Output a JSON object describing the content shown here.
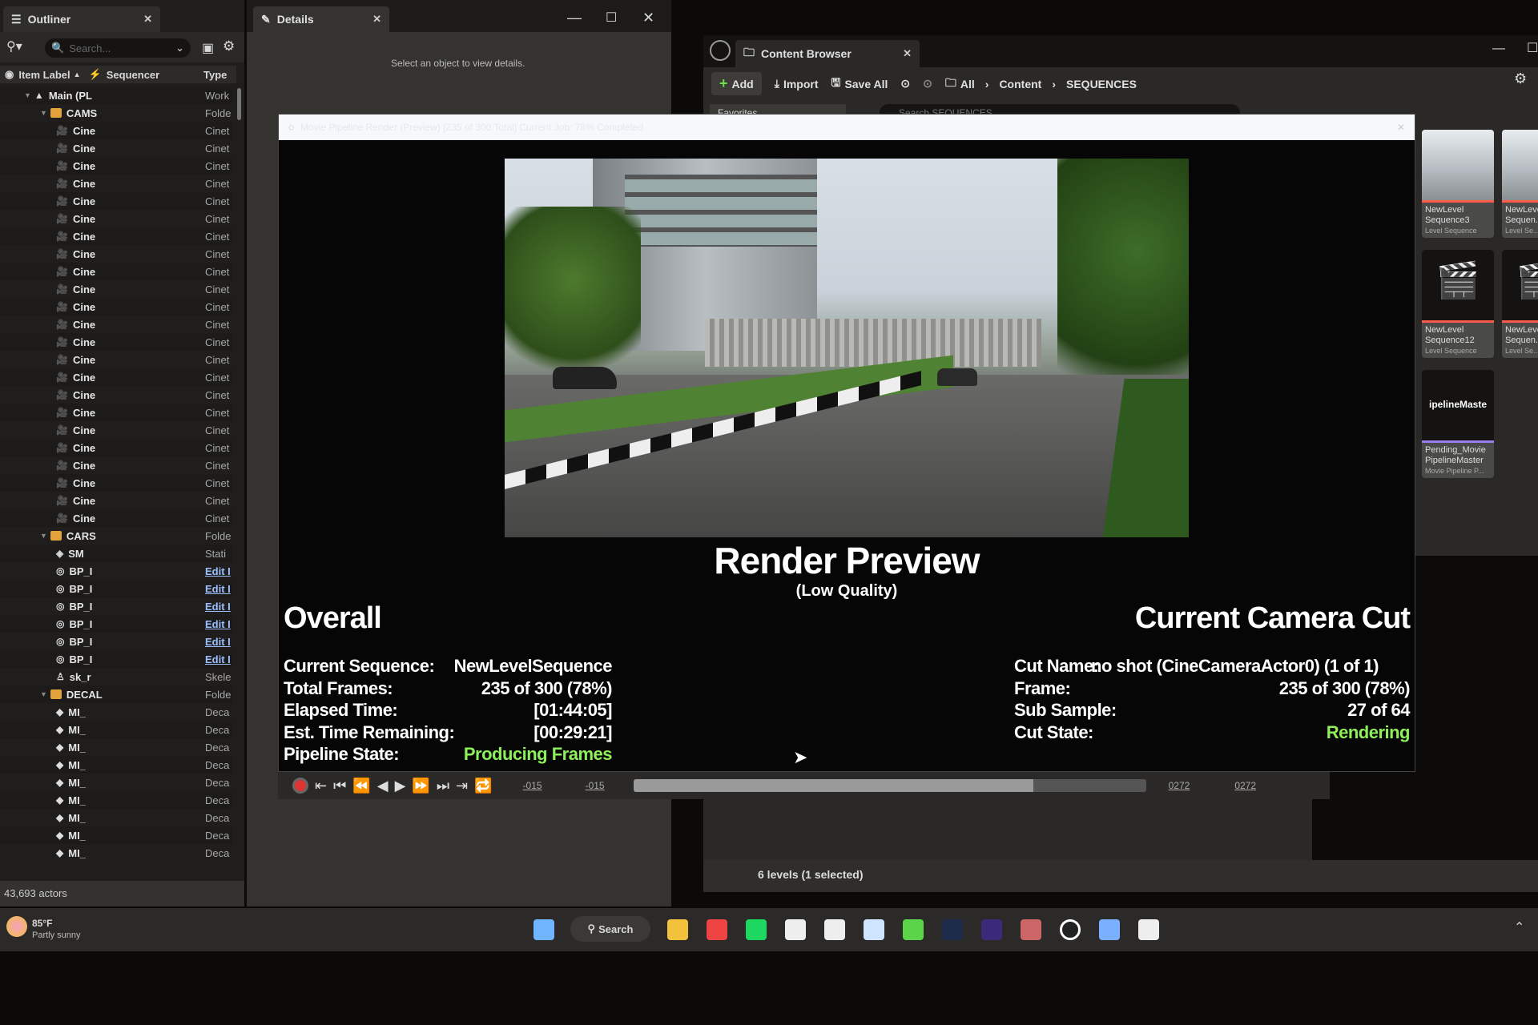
{
  "outliner": {
    "tab_label": "Outliner",
    "search_placeholder": "Search...",
    "columns": {
      "label": "Item Label",
      "sequencer": "Sequencer",
      "type": "Type"
    },
    "rows": [
      {
        "indent": 1,
        "kind": "world",
        "label": "Main (PL",
        "type": "Work"
      },
      {
        "indent": 2,
        "kind": "folder",
        "label": "CAMS",
        "type": "Folde"
      },
      {
        "indent": 3,
        "kind": "cam",
        "label": "Cine",
        "type": "Cinet"
      },
      {
        "indent": 3,
        "kind": "cam",
        "label": "Cine",
        "type": "Cinet"
      },
      {
        "indent": 3,
        "kind": "cam",
        "label": "Cine",
        "type": "Cinet"
      },
      {
        "indent": 3,
        "kind": "cam",
        "label": "Cine",
        "type": "Cinet"
      },
      {
        "indent": 3,
        "kind": "cam",
        "label": "Cine",
        "type": "Cinet"
      },
      {
        "indent": 3,
        "kind": "cam",
        "label": "Cine",
        "type": "Cinet"
      },
      {
        "indent": 3,
        "kind": "cam",
        "label": "Cine",
        "type": "Cinet"
      },
      {
        "indent": 3,
        "kind": "cam",
        "label": "Cine",
        "type": "Cinet"
      },
      {
        "indent": 3,
        "kind": "cam",
        "label": "Cine",
        "type": "Cinet"
      },
      {
        "indent": 3,
        "kind": "cam",
        "label": "Cine",
        "type": "Cinet"
      },
      {
        "indent": 3,
        "kind": "cam",
        "label": "Cine",
        "type": "Cinet"
      },
      {
        "indent": 3,
        "kind": "cam",
        "label": "Cine",
        "type": "Cinet"
      },
      {
        "indent": 3,
        "kind": "cam",
        "label": "Cine",
        "type": "Cinet"
      },
      {
        "indent": 3,
        "kind": "cam",
        "label": "Cine",
        "type": "Cinet"
      },
      {
        "indent": 3,
        "kind": "cam",
        "label": "Cine",
        "type": "Cinet"
      },
      {
        "indent": 3,
        "kind": "cam",
        "label": "Cine",
        "type": "Cinet"
      },
      {
        "indent": 3,
        "kind": "cam",
        "label": "Cine",
        "type": "Cinet"
      },
      {
        "indent": 3,
        "kind": "cam",
        "label": "Cine",
        "type": "Cinet"
      },
      {
        "indent": 3,
        "kind": "cam",
        "label": "Cine",
        "type": "Cinet"
      },
      {
        "indent": 3,
        "kind": "cam",
        "label": "Cine",
        "type": "Cinet"
      },
      {
        "indent": 3,
        "kind": "cam",
        "label": "Cine",
        "type": "Cinet"
      },
      {
        "indent": 3,
        "kind": "cam",
        "label": "Cine",
        "type": "Cinet"
      },
      {
        "indent": 3,
        "kind": "cam",
        "label": "Cine",
        "type": "Cinet"
      },
      {
        "indent": 2,
        "kind": "folder",
        "label": "CARS",
        "type": "Folde"
      },
      {
        "indent": 3,
        "kind": "mesh",
        "label": "SM",
        "type": "Stati"
      },
      {
        "indent": 3,
        "kind": "bp",
        "label": "BP_I",
        "type": "Edit I",
        "link": true
      },
      {
        "indent": 3,
        "kind": "bp",
        "label": "BP_I",
        "type": "Edit I",
        "link": true
      },
      {
        "indent": 3,
        "kind": "bp",
        "label": "BP_I",
        "type": "Edit I",
        "link": true
      },
      {
        "indent": 3,
        "kind": "bp",
        "label": "BP_I",
        "type": "Edit I",
        "link": true
      },
      {
        "indent": 3,
        "kind": "bp",
        "label": "BP_I",
        "type": "Edit I",
        "link": true
      },
      {
        "indent": 3,
        "kind": "bp",
        "label": "BP_I",
        "type": "Edit I",
        "link": true
      },
      {
        "indent": 3,
        "kind": "skel",
        "label": "sk_r",
        "type": "Skele"
      },
      {
        "indent": 2,
        "kind": "folder",
        "label": "DECAL",
        "type": "Folde"
      },
      {
        "indent": 3,
        "kind": "decal",
        "label": "MI_",
        "type": "Deca"
      },
      {
        "indent": 3,
        "kind": "decal",
        "label": "MI_",
        "type": "Deca"
      },
      {
        "indent": 3,
        "kind": "decal",
        "label": "MI_",
        "type": "Deca"
      },
      {
        "indent": 3,
        "kind": "decal",
        "label": "MI_",
        "type": "Deca"
      },
      {
        "indent": 3,
        "kind": "decal",
        "label": "MI_",
        "type": "Deca"
      },
      {
        "indent": 3,
        "kind": "decal",
        "label": "MI_",
        "type": "Deca"
      },
      {
        "indent": 3,
        "kind": "decal",
        "label": "MI_",
        "type": "Deca"
      },
      {
        "indent": 3,
        "kind": "decal",
        "label": "MI_",
        "type": "Deca"
      },
      {
        "indent": 3,
        "kind": "decal",
        "label": "MI_",
        "type": "Deca"
      }
    ],
    "footer": "43,693 actors"
  },
  "details": {
    "tab_label": "Details",
    "empty_message": "Select an object to view details."
  },
  "content_browser": {
    "tab_label": "Content Browser",
    "add": "Add",
    "import": "Import",
    "save_all": "Save All",
    "breadcrumb": [
      "All",
      "Content",
      "SEQUENCES"
    ],
    "favorites": "Favorites",
    "search_placeholder": "Search SEQUENCES",
    "assets": [
      {
        "name": "NewLevel Sequence3",
        "type": "Level Sequence",
        "color": "#ff5a4a"
      },
      {
        "name": "NewLevel Sequen...",
        "type": "Level Se...",
        "color": "#ff5a4a"
      },
      {
        "name": "NewLevel Sequence12",
        "type": "Level Sequence",
        "color": "#ff5a4a"
      },
      {
        "name": "NewLevel Sequen...",
        "type": "Level Se...",
        "color": "#ff5a4a"
      },
      {
        "name": "Pending_Movie PipelineMaster",
        "type": "Movie Pipeline P...",
        "thumb_text": "ipelineMaste",
        "color": "#9a7ef0"
      }
    ],
    "status": "6 levels (1 selected)"
  },
  "render_dialog": {
    "title": "Movie Pipeline Render (Preview) [235 of 300 Total] Current Job: 78% Completed",
    "heading": "Render Preview",
    "subheading": "(Low Quality)",
    "overall": {
      "title": "Overall",
      "rows": [
        {
          "label": "Current Sequence:",
          "value": "NewLevelSequence"
        },
        {
          "label": "Total Frames:",
          "value": "235 of 300 (78%)"
        },
        {
          "label": "Elapsed Time:",
          "value": "[01:44:05]"
        },
        {
          "label": "Est. Time Remaining:",
          "value": "[00:29:21]"
        },
        {
          "label": "Pipeline State:",
          "value": "Producing Frames",
          "status": true
        }
      ]
    },
    "camera_cut": {
      "title": "Current Camera Cut",
      "rows": [
        {
          "label": "Cut Name:",
          "value": "no shot (CineCameraActor0) (1 of 1)"
        },
        {
          "label": "Frame:",
          "value": "235 of 300 (78%)"
        },
        {
          "label": "Sub Sample:",
          "value": "27 of 64"
        },
        {
          "label": "Cut State:",
          "value": "Rendering",
          "status": true
        }
      ]
    },
    "status_color": "#8ef05a",
    "timeline": {
      "start_a": "-015",
      "start_b": "-015",
      "end_a": "0272",
      "end_b": "0272",
      "progress": 0.78
    }
  },
  "taskbar": {
    "weather_temp": "85°F",
    "weather_desc": "Partly sunny",
    "search": "Search",
    "apps": [
      "windows-start",
      "search",
      "file-explorer",
      "chrome",
      "spotify",
      "app",
      "app",
      "app",
      "app",
      "photoshop",
      "premiere",
      "app",
      "unreal-engine",
      "security",
      "app"
    ]
  }
}
